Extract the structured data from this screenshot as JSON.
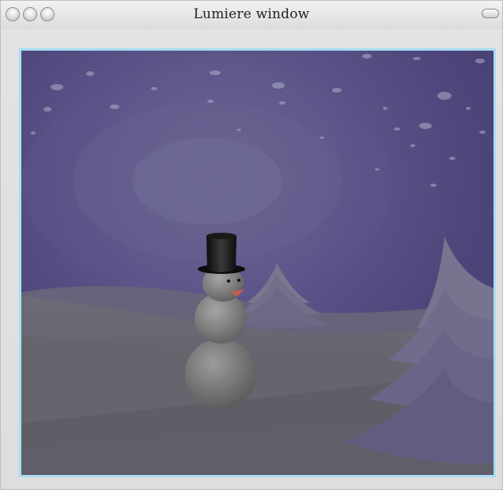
{
  "window": {
    "title": "Lumiere window"
  },
  "controls": {
    "close": "close-icon",
    "minimize": "minimize-icon",
    "zoom": "zoom-icon",
    "toolbar_toggle": "toolbar-toggle-icon"
  },
  "scene": {
    "colors": {
      "sky_dark": "#463d74",
      "sky_mid": "#5a5083",
      "sky_glow": "#6b6690",
      "snow_light": "#6b6872",
      "snow_dark": "#5d5b63",
      "tree": "#6c687e",
      "snowman": "#7a7a7a",
      "hat": "#111111",
      "nose": "#c75b4a",
      "frame": "#a9ddf3"
    }
  }
}
